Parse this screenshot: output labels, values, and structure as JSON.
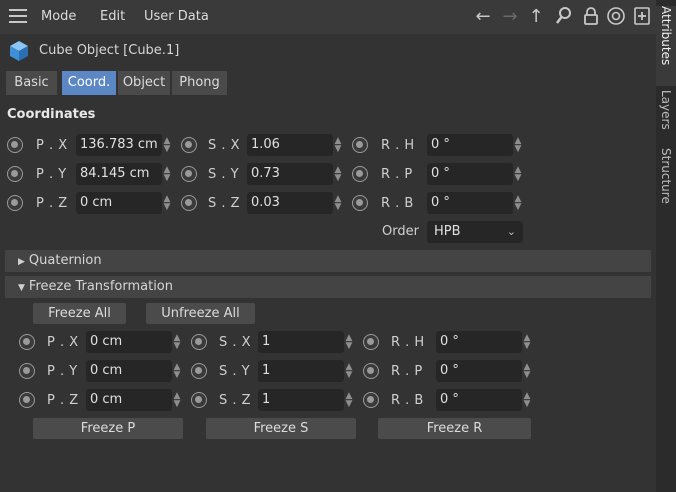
{
  "menu": {
    "mode": "Mode",
    "edit": "Edit",
    "user_data": "User Data"
  },
  "toolbar_icons": [
    "arrow-left-icon",
    "arrow-right-icon",
    "arrow-up-icon",
    "search-icon",
    "lock-icon",
    "target-icon",
    "new-panel-icon"
  ],
  "object": {
    "title": "Cube Object [Cube.1]",
    "icon": "cube-icon"
  },
  "tabs": [
    {
      "label": "Basic",
      "active": false
    },
    {
      "label": "Coord.",
      "active": true
    },
    {
      "label": "Object",
      "active": false
    },
    {
      "label": "Phong",
      "active": false
    }
  ],
  "coordinates": {
    "title": "Coordinates",
    "pos": [
      {
        "label": "P . X",
        "value": "136.783 cm"
      },
      {
        "label": "P . Y",
        "value": "84.145 cm"
      },
      {
        "label": "P . Z",
        "value": "0 cm"
      }
    ],
    "scale": [
      {
        "label": "S . X",
        "value": "1.06"
      },
      {
        "label": "S . Y",
        "value": "0.73"
      },
      {
        "label": "S . Z",
        "value": "0.03"
      }
    ],
    "rot": [
      {
        "label": "R . H",
        "value": "0 °"
      },
      {
        "label": "R . P",
        "value": "0 °"
      },
      {
        "label": "R . B",
        "value": "0 °"
      }
    ],
    "order_label": "Order",
    "order_value": "HPB"
  },
  "quaternion": {
    "label": "Quaternion"
  },
  "freeze": {
    "label": "Freeze Transformation",
    "freeze_all": "Freeze All",
    "unfreeze_all": "Unfreeze All",
    "pos": [
      {
        "label": "P . X",
        "value": "0 cm"
      },
      {
        "label": "P . Y",
        "value": "0 cm"
      },
      {
        "label": "P . Z",
        "value": "0 cm"
      }
    ],
    "scale": [
      {
        "label": "S . X",
        "value": "1"
      },
      {
        "label": "S . Y",
        "value": "1"
      },
      {
        "label": "S . Z",
        "value": "1"
      }
    ],
    "rot": [
      {
        "label": "R . H",
        "value": "0 °"
      },
      {
        "label": "R . P",
        "value": "0 °"
      },
      {
        "label": "R . B",
        "value": "0 °"
      }
    ],
    "freeze_p": "Freeze P",
    "freeze_s": "Freeze S",
    "freeze_r": "Freeze R"
  },
  "side_tabs": [
    {
      "label": "Attributes",
      "active": true
    },
    {
      "label": "Layers",
      "active": false
    },
    {
      "label": "Structure",
      "active": false
    }
  ],
  "colors": {
    "accent": "#5b87c4",
    "panel": "#333333",
    "field": "#262626"
  }
}
